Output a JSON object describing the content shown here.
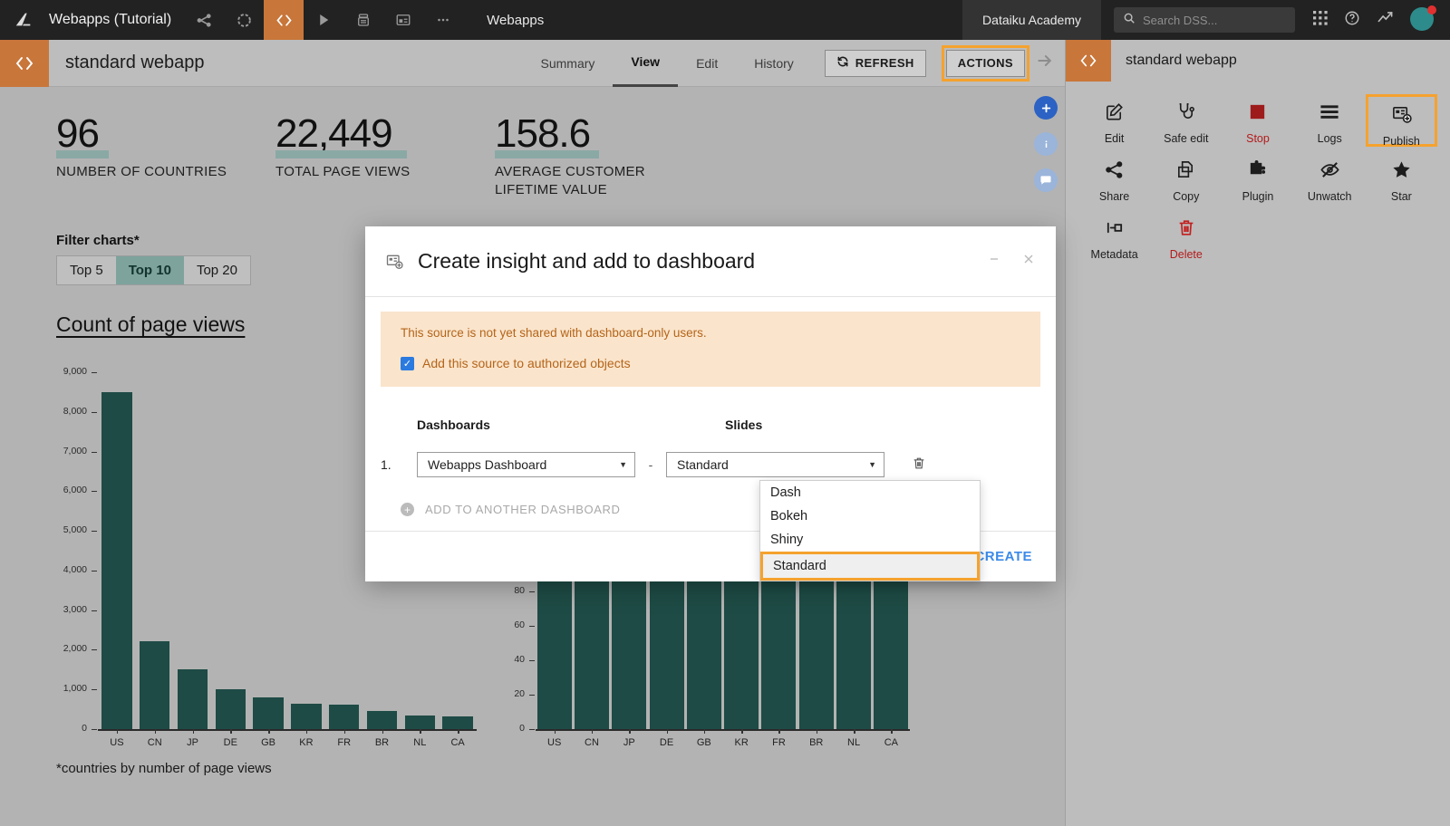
{
  "topbar": {
    "logo_icon": "dataiku-logo-icon",
    "project_name": "Webapps (Tutorial)",
    "tabs": [
      {
        "icon": "flow-icon",
        "name": "flow"
      },
      {
        "icon": "lab-icon",
        "name": "lab"
      },
      {
        "icon": "code-icon",
        "name": "code",
        "active": true
      },
      {
        "icon": "scenarios-icon",
        "name": "automation"
      },
      {
        "icon": "notebooks-icon",
        "name": "notebooks"
      },
      {
        "icon": "dashboards-icon",
        "name": "dashboards"
      },
      {
        "icon": "more-icon",
        "name": "more"
      }
    ],
    "section_label": "Webapps",
    "academy_label": "Dataiku Academy",
    "search_placeholder": "Search DSS...",
    "apps_icon": "apps-grid-icon",
    "help_icon": "help-icon",
    "monitoring_icon": "trend-icon",
    "avatar_initial": "",
    "accent_orange": "#c8763a"
  },
  "objbar": {
    "icon": "code-webapp-icon",
    "title": "standard webapp",
    "tabs": [
      {
        "label": "Summary",
        "active": false
      },
      {
        "label": "View",
        "active": true
      },
      {
        "label": "Edit",
        "active": false
      },
      {
        "label": "History",
        "active": false
      }
    ],
    "refresh_label": "REFRESH",
    "refresh_icon": "refresh-icon",
    "actions_label": "ACTIONS",
    "collapse_icon": "arrow-right-icon",
    "highlight_color": "#f5a22e"
  },
  "right_panel": {
    "icon": "code-webapp-icon",
    "title": "standard webapp",
    "actions": [
      {
        "label": "Edit",
        "icon": "pencil-square-icon",
        "style": "normal"
      },
      {
        "label": "Safe edit",
        "icon": "stethoscope-icon",
        "style": "normal"
      },
      {
        "label": "Stop",
        "icon": "stop-square-icon",
        "style": "danger"
      },
      {
        "label": "Logs",
        "icon": "logs-lines-icon",
        "style": "normal"
      },
      {
        "label": "Publish",
        "icon": "publish-insight-icon",
        "style": "normal",
        "highlighted": true
      },
      {
        "label": "Share",
        "icon": "share-icon",
        "style": "normal"
      },
      {
        "label": "Copy",
        "icon": "copy-icon",
        "style": "normal"
      },
      {
        "label": "Plugin",
        "icon": "puzzle-icon",
        "style": "normal"
      },
      {
        "label": "Unwatch",
        "icon": "eye-slash-icon",
        "style": "normal"
      },
      {
        "label": "Star",
        "icon": "star-icon",
        "style": "normal"
      },
      {
        "label": "Metadata",
        "icon": "metadata-icon",
        "style": "normal"
      },
      {
        "label": "Delete",
        "icon": "trash-icon",
        "style": "danger"
      }
    ]
  },
  "fabs": [
    {
      "name": "add-insight-fab",
      "icon": "plus-icon",
      "color": "#2b62c4"
    },
    {
      "name": "info-fab",
      "icon": "info-icon",
      "color": "#9ab4da"
    },
    {
      "name": "discussions-fab",
      "icon": "chat-icon",
      "color": "#9ab4da"
    }
  ],
  "webapp": {
    "kpis": [
      {
        "value": "96",
        "label": "NUMBER OF COUNTRIES"
      },
      {
        "value": "22,449",
        "label": "TOTAL PAGE VIEWS"
      },
      {
        "value": "158.6",
        "label": "AVERAGE CUSTOMER LIFETIME VALUE"
      }
    ],
    "kpi_underline_color": "#8aa9a5",
    "filter_title": "Filter charts*",
    "filter_options": [
      {
        "label": "Top 5",
        "active": false
      },
      {
        "label": "Top 10",
        "active": true
      },
      {
        "label": "Top 20",
        "active": false
      }
    ],
    "chart_title": "Count of page views",
    "footnote": "*countries by number of page views"
  },
  "chart_data": [
    {
      "type": "bar",
      "title": "Count of page views",
      "xlabel": "",
      "ylabel": "",
      "categories": [
        "US",
        "CN",
        "JP",
        "DE",
        "GB",
        "KR",
        "FR",
        "BR",
        "NL",
        "CA"
      ],
      "values": [
        8500,
        2220,
        1500,
        1000,
        790,
        650,
        610,
        450,
        350,
        330
      ],
      "ylim": [
        0,
        9000
      ],
      "yticks": [
        0,
        1000,
        2000,
        3000,
        4000,
        5000,
        6000,
        7000,
        8000,
        9000
      ],
      "ytick_labels": [
        "0",
        "1,000",
        "2,000",
        "3,000",
        "4,000",
        "5,000",
        "6,000",
        "7,000",
        "8,000",
        "9,000"
      ],
      "bar_color": "#1e4b45",
      "grid": false,
      "legend": "none"
    },
    {
      "type": "bar",
      "title": "",
      "xlabel": "",
      "ylabel": "",
      "categories": [
        "US",
        "CN",
        "JP",
        "DE",
        "GB",
        "KR",
        "FR",
        "BR",
        "NL",
        "CA"
      ],
      "values": [
        92,
        92,
        92,
        92,
        92,
        92,
        92,
        92,
        92,
        92
      ],
      "ylim": [
        0,
        95
      ],
      "yticks": [
        0,
        20,
        40,
        60,
        80
      ],
      "ytick_labels": [
        "0",
        "20",
        "40",
        "60",
        "80"
      ],
      "bar_color": "#1e4b45",
      "grid": false,
      "legend": "none"
    }
  ],
  "modal": {
    "icon": "publish-insight-icon",
    "title": "Create insight and add to dashboard",
    "minimize_icon": "minimize-icon",
    "close_icon": "close-icon",
    "warning_text": "This source is not yet shared with dashboard-only users.",
    "checkbox_label": "Add this source to authorized objects",
    "checkbox_checked": true,
    "col_dashboards": "Dashboards",
    "col_slides": "Slides",
    "row_number": "1.",
    "dashboard_value": "Webapps Dashboard",
    "separator": "-",
    "slide_value": "Standard",
    "delete_icon": "trash-icon",
    "add_another_label": "ADD TO ANOTHER DASHBOARD",
    "add_icon": "plus-circle-icon",
    "create_label": "CREATE",
    "warning_bg": "#fae4cb",
    "warning_fg": "#b4651a"
  },
  "dropdown": {
    "options": [
      {
        "label": "Dash",
        "selected": false
      },
      {
        "label": "Bokeh",
        "selected": false
      },
      {
        "label": "Shiny",
        "selected": false
      },
      {
        "label": "Standard",
        "selected": true
      }
    ],
    "highlight_color": "#f5a22e"
  }
}
